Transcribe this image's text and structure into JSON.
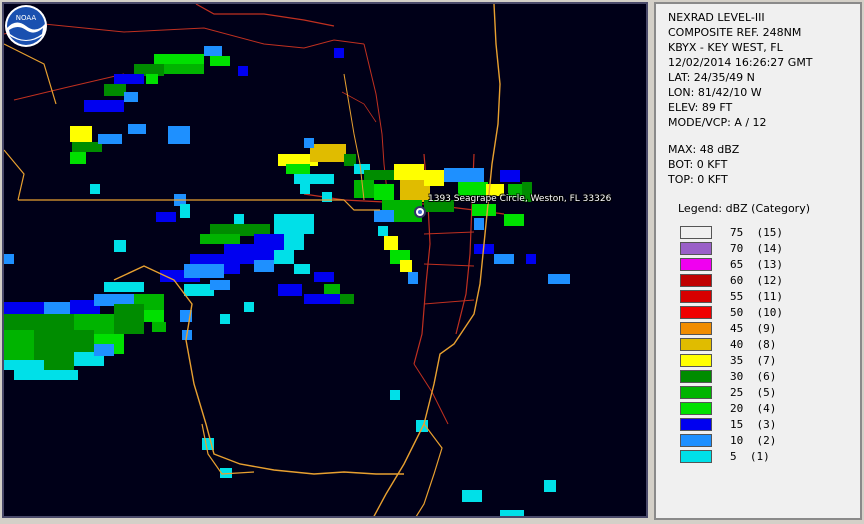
{
  "map": {
    "location_label": "1393 Seagrape Circle, Weston, FL 33326",
    "logo_text": "NOAA",
    "colors": {
      "background": "#000018",
      "coastline": "#e8a030",
      "roads": "#c03020"
    }
  },
  "panel": {
    "info_lines": [
      "NEXRAD LEVEL-III",
      "COMPOSITE REF. 248NM",
      "KBYX - KEY WEST, FL",
      "12/02/2014 16:26:27 GMT",
      "LAT: 24/35/49 N",
      "LON: 81/42/10 W",
      "ELEV: 89 FT",
      "MODE/VCP: A / 12"
    ],
    "stats_lines": [
      "MAX: 48 dBZ",
      "BOT: 0 KFT",
      "TOP: 0 KFT"
    ],
    "legend_title": "Legend: dBZ (Category)",
    "legend": [
      {
        "label": "75  (15)",
        "color": "#f0f0f0"
      },
      {
        "label": "70  (14)",
        "color": "#9a60c8"
      },
      {
        "label": "65  (13)",
        "color": "#f000f0"
      },
      {
        "label": "60  (12)",
        "color": "#c00000"
      },
      {
        "label": "55  (11)",
        "color": "#d80000"
      },
      {
        "label": "50  (10)",
        "color": "#f00000"
      },
      {
        "label": "45  (9)",
        "color": "#f08c00"
      },
      {
        "label": "40  (8)",
        "color": "#e0bc00"
      },
      {
        "label": "35  (7)",
        "color": "#ffff00"
      },
      {
        "label": "30  (6)",
        "color": "#008c00"
      },
      {
        "label": "25  (5)",
        "color": "#00b400"
      },
      {
        "label": "20  (4)",
        "color": "#00e000"
      },
      {
        "label": "15  (3)",
        "color": "#0000f0"
      },
      {
        "label": "10  (2)",
        "color": "#1e90ff"
      },
      {
        "label": "5  (1)",
        "color": "#00e0e8"
      }
    ]
  }
}
